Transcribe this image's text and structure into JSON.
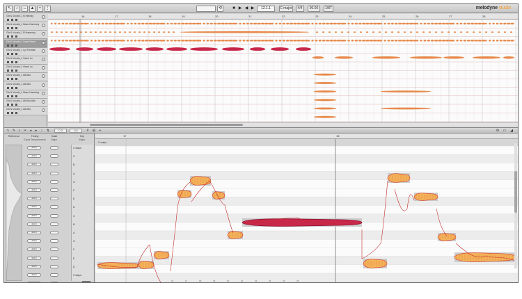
{
  "app": {
    "name": "melodyne",
    "edition": "studio"
  },
  "toolbar": {
    "position": "12.1.1",
    "tempo_mode": "C major",
    "meter": "4/4",
    "tempo": "90.00",
    "zoom": "1/8T"
  },
  "arrangement": {
    "bars": [
      "16",
      "17",
      "18",
      "19",
      "20",
      "21",
      "22",
      "23",
      "24",
      "25",
      "26",
      "27",
      "28"
    ],
    "tracks": [
      {
        "name": "Gtr & Vocals_1 B melody",
        "selected": false,
        "color": "#e8894a",
        "style": "dense"
      },
      {
        "name": "Gtr & Vocals_1 Bass Harmony",
        "selected": false,
        "color": "#e8894a",
        "style": "long"
      },
      {
        "name": "Gtr & Vocals_1 B Harmony",
        "selected": false,
        "color": "#e8894a",
        "style": "dense"
      },
      {
        "name": "Gtr & Vocals_1 Lead Vocal",
        "selected": true,
        "color": "#c8284a",
        "style": "lead"
      },
      {
        "name": "Gtr & Vocals_1 Lyr Female",
        "selected": false,
        "color": "#e8894a",
        "style": "late"
      },
      {
        "name": "Gtr & Vocals_1 Harm Lo",
        "selected": false,
        "color": "#e8894a",
        "style": "none"
      },
      {
        "name": "Gtr & Vocals_1 Harm Lo",
        "selected": false,
        "color": "#e8894a",
        "style": "short"
      },
      {
        "name": "Gtr & Vocals_1 Alt Alto",
        "selected": false,
        "color": "#e8894a",
        "style": "short"
      },
      {
        "name": "Gtr & Vocals_1 Alt Alto",
        "selected": false,
        "color": "#e8894a",
        "style": "shortlong"
      },
      {
        "name": "Gtr & Vocals_1 Bass Harmony",
        "selected": false,
        "color": "#e8894a",
        "style": "short"
      },
      {
        "name": "Gtr & Vocals_1 Alt Alto Alto",
        "selected": false,
        "color": "#e8894a",
        "style": "shortlong"
      },
      {
        "name": "Gtr & Vocals_1 Alt Alto",
        "selected": false,
        "color": "#e8894a",
        "style": "short"
      }
    ]
  },
  "editor_toolbar": {
    "pitch_field": "C 0",
    "time_field": "0.0"
  },
  "inspector": {
    "col1": "Reference",
    "col2": "Tuning",
    "col2_sub": "Equal Temperament",
    "col3": "Scale",
    "col3_sub": "Major",
    "col4": "Key",
    "col4_sub": "Major",
    "tunings": [
      "440.0",
      "440.0",
      "440.0",
      "440.0",
      "440.0",
      "440.0",
      "440.0",
      "440.0",
      "440.0",
      "440.0",
      "440.0",
      "440.0",
      "440.0",
      "440.0",
      "440.0",
      "440.0",
      "440.0"
    ],
    "keys": [
      "C Major",
      "C",
      "B",
      "A",
      "G",
      "F",
      "E",
      "D",
      "C",
      "B",
      "A",
      "G",
      "F",
      "E",
      "D",
      "C Major",
      "B"
    ]
  },
  "note_editor": {
    "bars": [
      "17",
      "18"
    ],
    "scale_label": "C major",
    "bottom_ticks": [
      "16",
      "17",
      "18",
      "19",
      "20",
      "21",
      "22",
      "23",
      "24",
      "25"
    ]
  },
  "colors": {
    "note_fill": "#f3b35a",
    "note_dark": "#d9472f",
    "lead_fill": "#c8284a",
    "pitch_curve": "#c42a2a",
    "accent": "#f39b2f"
  }
}
